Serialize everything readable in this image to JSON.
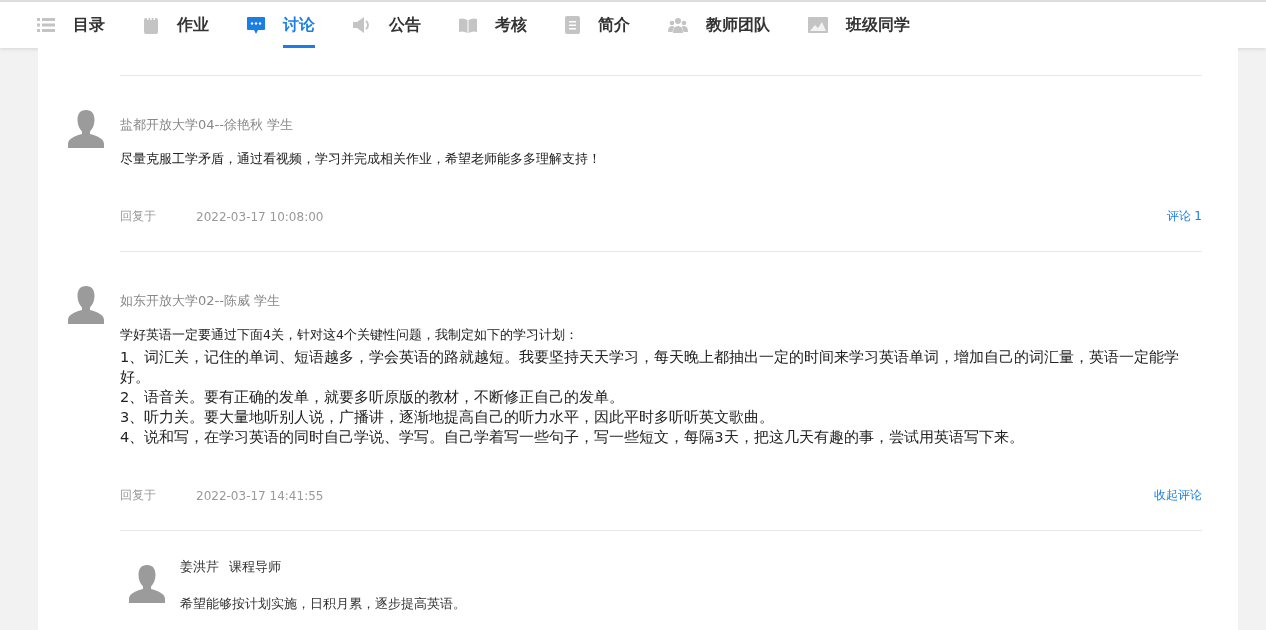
{
  "tabs": [
    {
      "label": "目录",
      "kind": "list",
      "selected": false
    },
    {
      "label": "作业",
      "kind": "notebook",
      "selected": false
    },
    {
      "label": "讨论",
      "kind": "chat",
      "selected": true
    },
    {
      "label": "公告",
      "kind": "speaker",
      "selected": false
    },
    {
      "label": "考核",
      "kind": "book",
      "selected": false
    },
    {
      "label": "简介",
      "kind": "document",
      "selected": false
    },
    {
      "label": "教师团队",
      "kind": "people",
      "selected": false
    },
    {
      "label": "班级同学",
      "kind": "picture",
      "selected": false
    }
  ],
  "posts": [
    {
      "author": "盐都开放大学04--徐艳秋 学生",
      "lead": "尽量克服工学矛盾，通过看视频，学习并完成相关作业，希望老师能多多理解支持！",
      "reply_label": "回复于",
      "time": "2022-03-17 10:08:00",
      "action": "评论 1"
    },
    {
      "author": "如东开放大学02--陈威 学生",
      "lead": "学好英语一定要通过下面4关，针对这4个关键性问题，我制定如下的学习计划：",
      "items": [
        "1、词汇关，记住的单词、短语越多，学会英语的路就越短。我要坚持天天学习，每天晚上都抽出一定的时间来学习英语单词，增加自己的词汇量，英语一定能学好。",
        "2、语音关。要有正确的发单，就要多听原版的教材，不断修正自己的发单。",
        "3、听力关。要大量地听别人说，广播讲，逐渐地提高自己的听力水平，因此平时多听听英文歌曲。",
        "4、说和写，在学习英语的同时自己学说、学写。自己学着写一些句子，写一些短文，每隔3天，把这几天有趣的事，尝试用英语写下来。"
      ],
      "reply_label": "回复于",
      "time": "2022-03-17 14:41:55",
      "action": "收起评论",
      "replies": [
        {
          "name": "姜洪芹",
          "role": "课程导师",
          "text": "希望能够按计划实施，日积月累，逐步提高英语。"
        }
      ]
    }
  ]
}
